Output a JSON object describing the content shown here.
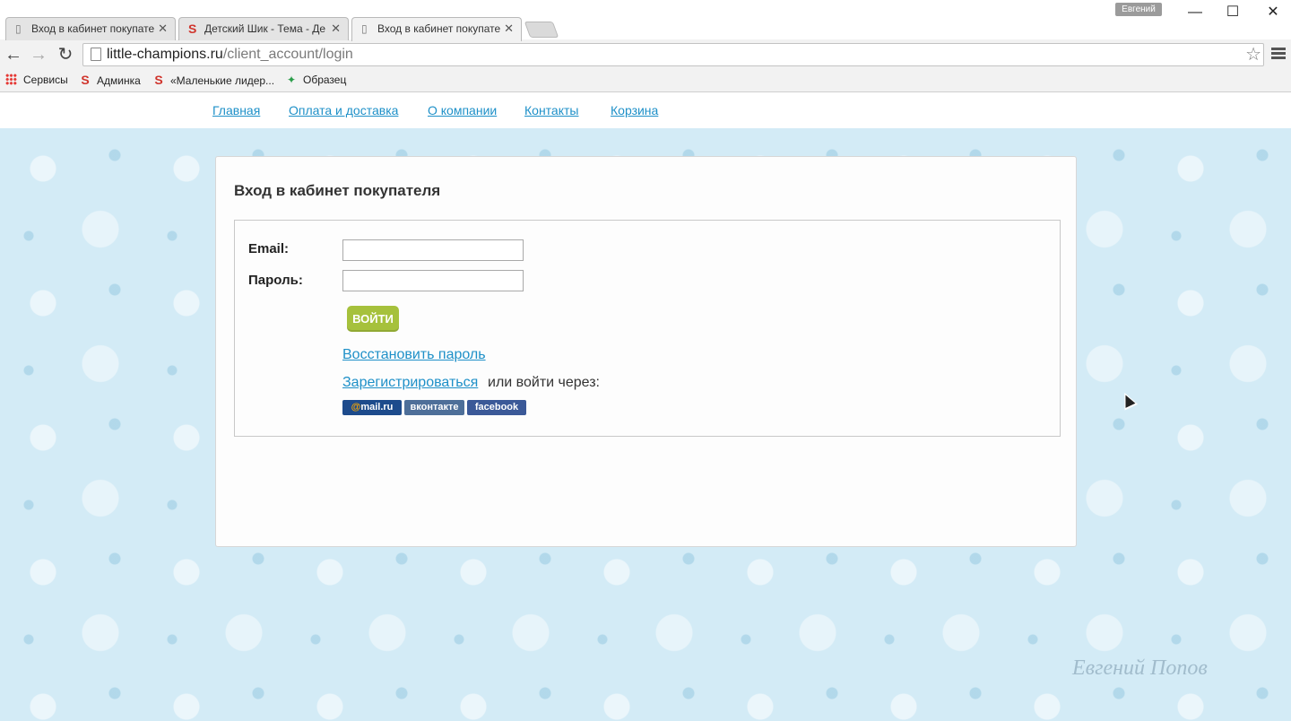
{
  "browser": {
    "tabs": [
      {
        "title": "Вход в кабинет покупате",
        "icon": "page-icon",
        "active": false
      },
      {
        "title": "Детский Шик - Тема - Де",
        "icon": "s-logo-icon",
        "active": false
      },
      {
        "title": "Вход в кабинет покупате",
        "icon": "page-icon",
        "active": true
      }
    ],
    "user_name": "Евгений",
    "url_host": "little-champions.ru",
    "url_path": "/client_account/login",
    "bookmarks": [
      {
        "label": "Сервисы",
        "icon": "apps-icon"
      },
      {
        "label": "Админка",
        "icon": "s-logo-icon"
      },
      {
        "label": "«Маленькие лидер...",
        "icon": "s-logo-icon"
      },
      {
        "label": "Образец",
        "icon": "colorful-star-icon"
      }
    ]
  },
  "site_nav": [
    "Главная",
    "Оплата и доставка",
    "О компании",
    "Контакты",
    "Корзина"
  ],
  "login": {
    "title": "Вход в кабинет покупателя",
    "email_label": "Email:",
    "password_label": "Пароль:",
    "email_value": "",
    "password_value": "",
    "submit_label": "ВОЙТИ",
    "restore_link": "Восстановить пароль",
    "register_link": "Зарегистрироваться",
    "or_text": "или войти через:",
    "social": [
      "mail.ru",
      "вконтакте",
      "facebook"
    ]
  },
  "watermark": "Евгений Попов",
  "colors": {
    "link": "#1e90c8",
    "button": "#a6c13c",
    "background": "#d3ebf6"
  }
}
